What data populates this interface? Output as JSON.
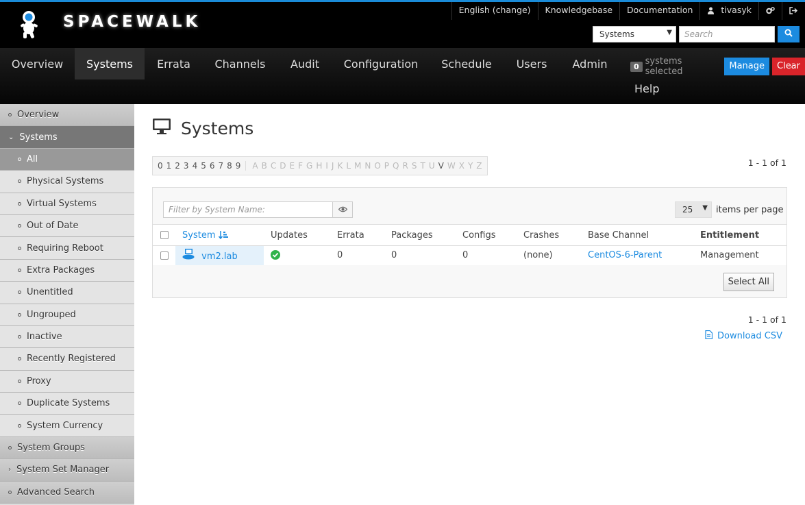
{
  "brand": "SPACEWALK",
  "toplinks": {
    "language": "English (change)",
    "knowledgebase": "Knowledgebase",
    "documentation": "Documentation",
    "user": "tivasyk"
  },
  "search": {
    "scope": "Systems",
    "placeholder": "Search"
  },
  "nav": {
    "items": [
      "Overview",
      "Systems",
      "Errata",
      "Channels",
      "Audit",
      "Configuration",
      "Schedule",
      "Users",
      "Admin"
    ],
    "help": "Help",
    "selected_count": "0",
    "selected_label": "systems selected",
    "manage": "Manage",
    "clear": "Clear"
  },
  "sidebar": {
    "overview": "Overview",
    "systems": "Systems",
    "all": "All",
    "sub": [
      "Physical Systems",
      "Virtual Systems",
      "Out of Date",
      "Requiring Reboot",
      "Extra Packages",
      "Unentitled",
      "Ungrouped",
      "Inactive",
      "Recently Registered",
      "Proxy",
      "Duplicate Systems",
      "System Currency"
    ],
    "system_groups": "System Groups",
    "ssm": "System Set Manager",
    "advanced_search": "Advanced Search"
  },
  "page": {
    "title": "Systems",
    "alpha_digits": [
      "0",
      "1",
      "2",
      "3",
      "4",
      "5",
      "6",
      "7",
      "8",
      "9"
    ],
    "alpha_letters": [
      "A",
      "B",
      "C",
      "D",
      "E",
      "F",
      "G",
      "H",
      "I",
      "J",
      "K",
      "L",
      "M",
      "N",
      "O",
      "P",
      "Q",
      "R",
      "S",
      "T",
      "U",
      "V",
      "W",
      "X",
      "Y",
      "Z"
    ],
    "alpha_active": "V",
    "count_top": "1 - 1 of 1",
    "count_bottom": "1 - 1 of 1",
    "filter_placeholder": "Filter by System Name:",
    "per_page": "25",
    "per_page_label": "items per page",
    "select_all": "Select All",
    "download_csv": "Download CSV"
  },
  "table": {
    "headers": [
      "System",
      "Updates",
      "Errata",
      "Packages",
      "Configs",
      "Crashes",
      "Base Channel",
      "Entitlement"
    ],
    "rows": [
      {
        "system": "vm2.lab",
        "errata": "0",
        "packages": "0",
        "configs": "0",
        "crashes": "(none)",
        "base_channel": "CentOS-6-Parent",
        "entitlement": "Management"
      }
    ]
  },
  "colors": {
    "accent": "#1c8be0",
    "danger": "#d9242a",
    "ok": "#2fb34a"
  }
}
